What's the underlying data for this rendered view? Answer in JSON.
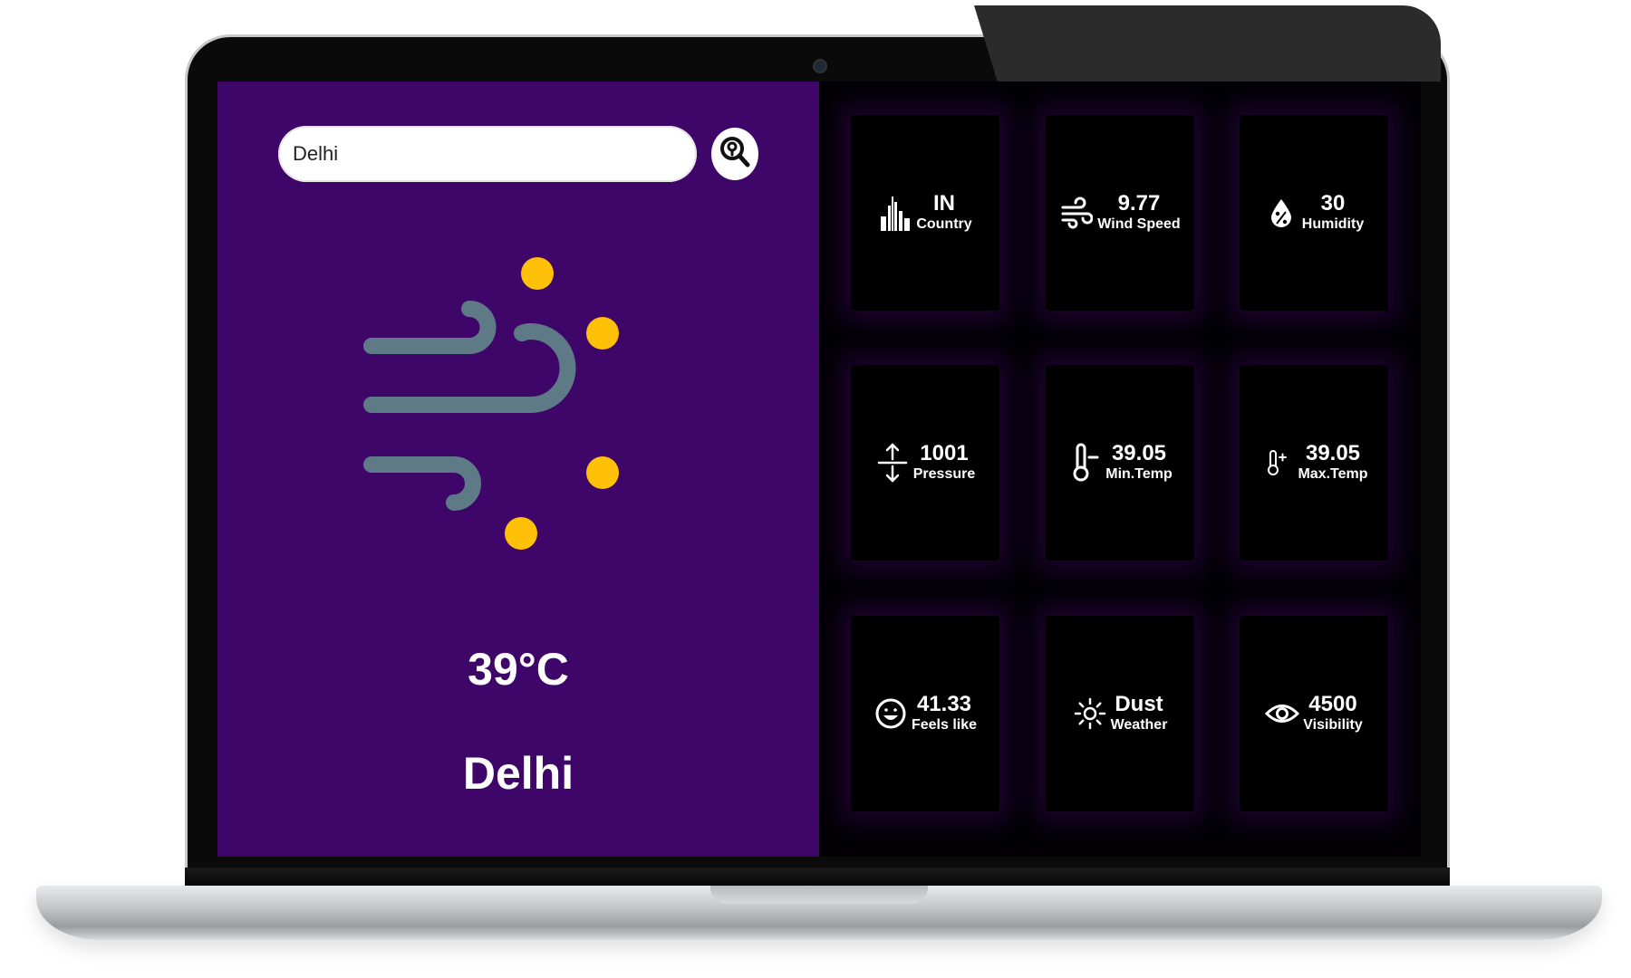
{
  "search": {
    "value": "Delhi"
  },
  "current": {
    "temperature": "39°C",
    "city": "Delhi",
    "condition_icon": "wind-sun-icon"
  },
  "cards": {
    "country": {
      "value": "IN",
      "label": "Country",
      "icon": "city-buildings-icon"
    },
    "wind_speed": {
      "value": "9.77",
      "label": "Wind Speed",
      "icon": "wind-icon"
    },
    "humidity": {
      "value": "30",
      "label": "Humidity",
      "icon": "humidity-drop-icon"
    },
    "pressure": {
      "value": "1001",
      "label": "Pressure",
      "icon": "pressure-arrows-icon"
    },
    "min_temp": {
      "value": "39.05",
      "label": "Min.Temp",
      "icon": "thermometer-minus-icon"
    },
    "max_temp": {
      "value": "39.05",
      "label": "Max.Temp",
      "icon": "thermometer-plus-icon"
    },
    "feels_like": {
      "value": "41.33",
      "label": "Feels like",
      "icon": "smiley-icon"
    },
    "weather": {
      "value": "Dust",
      "label": "Weather",
      "icon": "sun-icon"
    },
    "visibility": {
      "value": "4500",
      "label": "Visibility",
      "icon": "eye-icon"
    }
  },
  "colors": {
    "left_panel_bg": "#3f0669",
    "right_panel_bg": "#020005",
    "card_bg": "#000000",
    "wind_stroke": "#5f7a87",
    "sun_dot": "#ffc107"
  }
}
